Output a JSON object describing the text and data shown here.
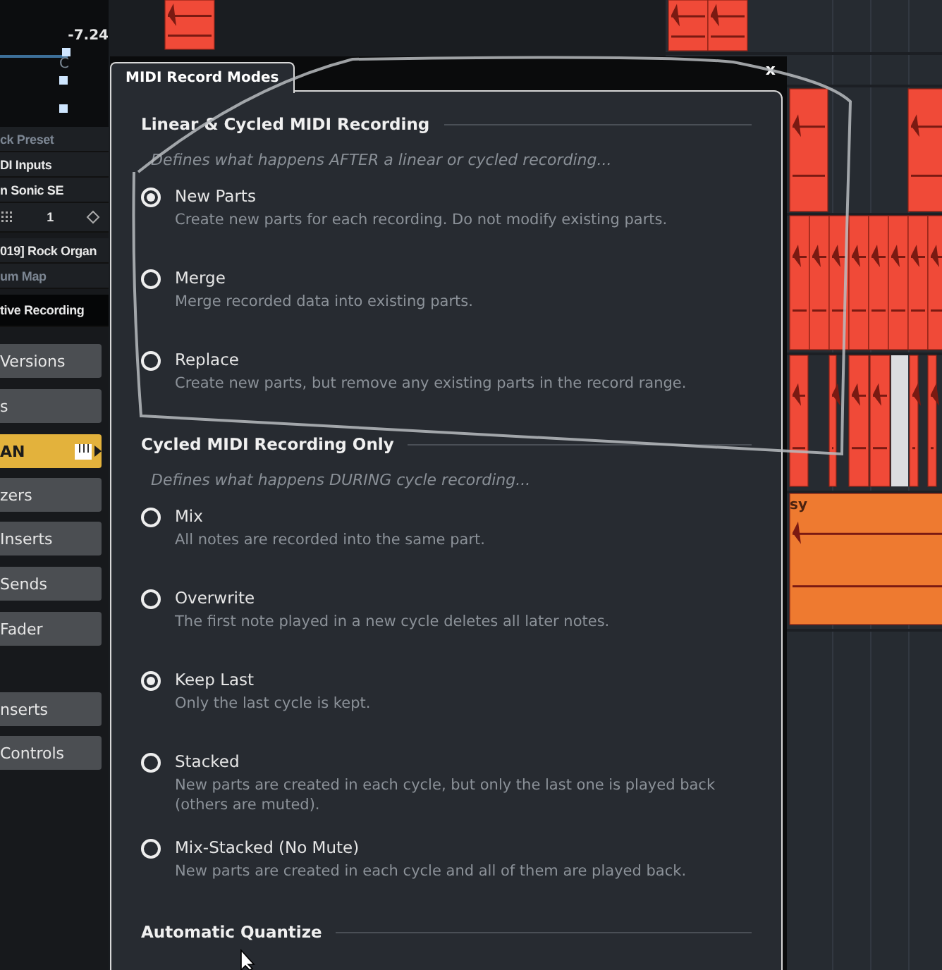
{
  "sidebar": {
    "readout": "-7.24",
    "pan_label": "C",
    "rows": [
      {
        "text": "ck Preset",
        "dimmed": true
      },
      {
        "text": "DI Inputs",
        "dimmed": false
      },
      {
        "text": "n Sonic SE",
        "dimmed": false
      },
      {
        "text": "1",
        "kind": "counter"
      },
      {
        "text": "019] Rock Organ",
        "dimmed": false
      },
      {
        "text": "um Map",
        "dimmed": true
      },
      {
        "text": "tive Recording",
        "dimmed": false
      }
    ],
    "buttons": [
      {
        "label": "Versions",
        "selected": false
      },
      {
        "label": "s",
        "selected": false
      },
      {
        "label": "AN",
        "selected": true
      },
      {
        "label": "zers",
        "selected": false
      },
      {
        "label": "Inserts",
        "selected": false
      },
      {
        "label": "Sends",
        "selected": false
      },
      {
        "label": "Fader",
        "selected": false
      },
      {
        "label": "nserts",
        "selected": false
      },
      {
        "label": "Controls",
        "selected": false
      }
    ]
  },
  "arrange": {
    "part_label": "sy"
  },
  "dialog": {
    "title": "MIDI Record Modes",
    "close": "x",
    "sections": [
      {
        "heading": "Linear & Cycled MIDI Recording",
        "description": "Defines what happens AFTER a linear or cycled recording...",
        "options": [
          {
            "label": "New Parts",
            "description": "Create new parts for each recording. Do not modify existing parts.",
            "selected": true
          },
          {
            "label": "Merge",
            "description": "Merge recorded data into existing parts.",
            "selected": false
          },
          {
            "label": "Replace",
            "description": "Create new parts, but remove any existing parts in the record range.",
            "selected": false
          }
        ]
      },
      {
        "heading": "Cycled MIDI Recording Only",
        "description": "Defines what happens DURING cycle recording...",
        "options": [
          {
            "label": "Mix",
            "description": "All notes are recorded into the same part.",
            "selected": false
          },
          {
            "label": "Overwrite",
            "description": "The first note played in a new cycle deletes all later notes.",
            "selected": false
          },
          {
            "label": "Keep Last",
            "description": "Only the last cycle is kept.",
            "selected": true
          },
          {
            "label": "Stacked",
            "description": "New parts are created in each cycle, but only the last one is played back (others are muted).",
            "selected": false
          },
          {
            "label": "Mix-Stacked (No Mute)",
            "description": "New parts are created in each cycle and all of them are played back.",
            "selected": false
          }
        ]
      },
      {
        "heading": "Automatic Quantize"
      }
    ]
  }
}
